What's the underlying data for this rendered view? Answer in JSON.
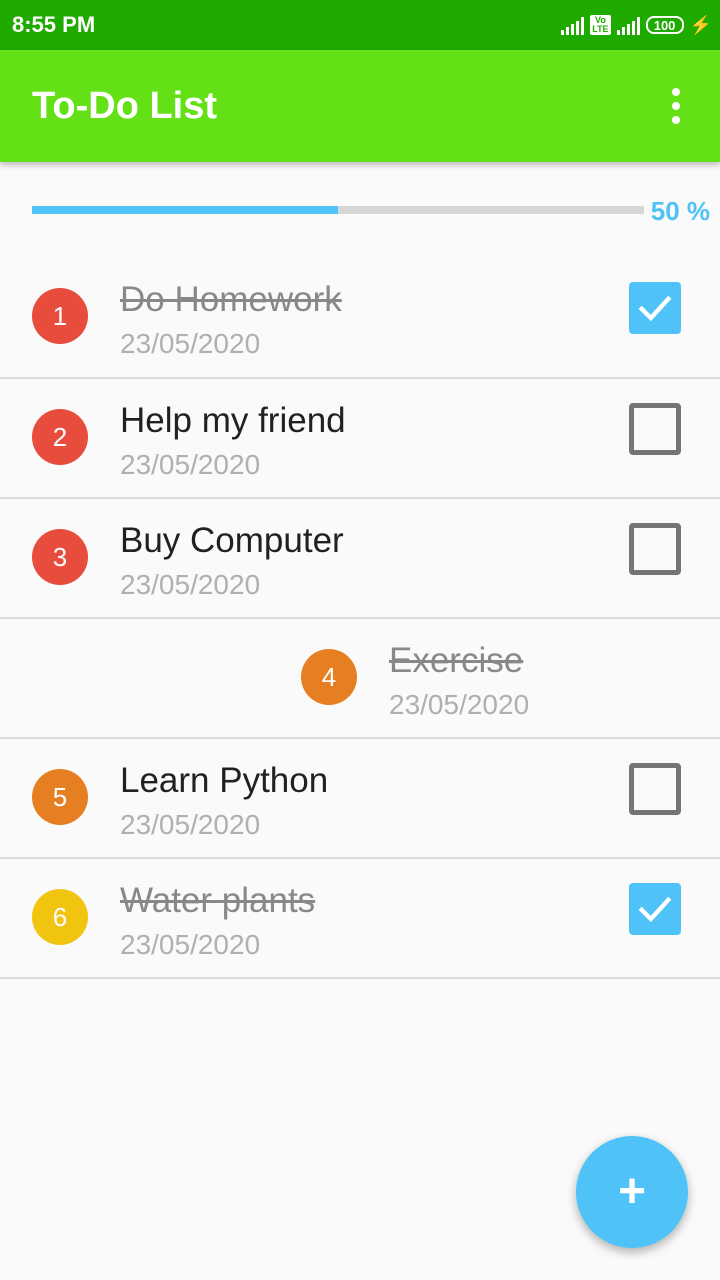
{
  "status_bar": {
    "time": "8:55 PM",
    "volte_top": "Vo",
    "volte_bottom": "LTE",
    "battery": "100"
  },
  "app_bar": {
    "title": "To-Do List",
    "menu_icon": "more-vert-icon"
  },
  "progress": {
    "percent": 50,
    "label": "50 %",
    "fill_color": "#4fc3f7"
  },
  "tasks": [
    {
      "number": "1",
      "title": "Do Homework",
      "date": "23/05/2020",
      "done": true,
      "badge_color": "#e74c3c"
    },
    {
      "number": "2",
      "title": "Help my friend",
      "date": "23/05/2020",
      "done": false,
      "badge_color": "#e74c3c"
    },
    {
      "number": "3",
      "title": "Buy Computer",
      "date": "23/05/2020",
      "done": false,
      "badge_color": "#e74c3c"
    },
    {
      "number": "4",
      "title": "Exercise",
      "date": "23/05/2020",
      "done": true,
      "badge_color": "#e67e22"
    },
    {
      "number": "5",
      "title": "Learn Python",
      "date": "23/05/2020",
      "done": false,
      "badge_color": "#e67e22"
    },
    {
      "number": "6",
      "title": "Water plants",
      "date": "23/05/2020",
      "done": true,
      "badge_color": "#f1c40f"
    }
  ],
  "fab": {
    "icon": "+",
    "icon_name": "add-icon",
    "color": "#4fc3f7"
  },
  "colors": {
    "status_bar": "#1faa00",
    "app_bar": "#64e016",
    "accent": "#4fc3f7"
  }
}
